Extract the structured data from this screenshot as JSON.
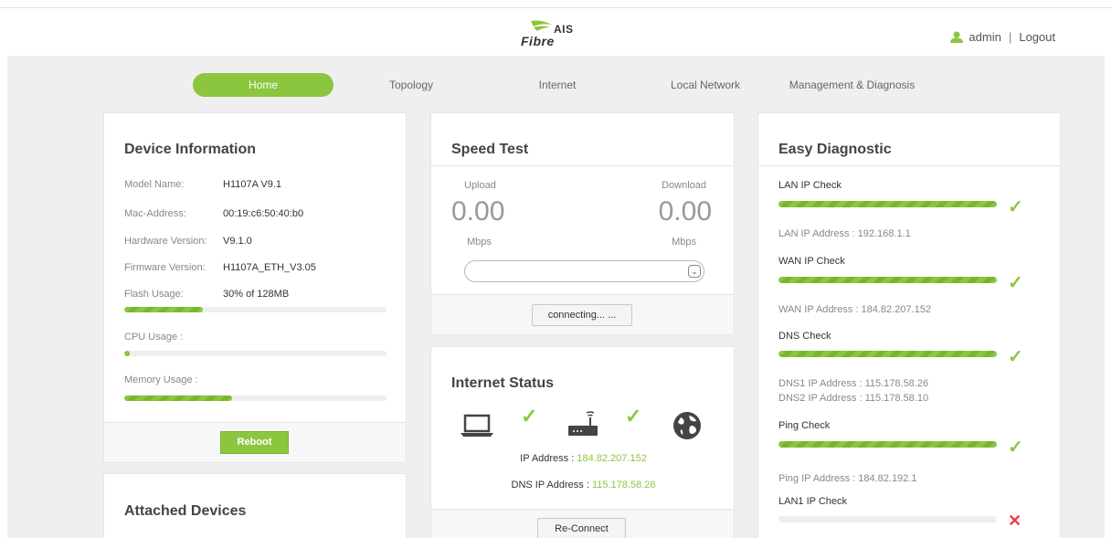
{
  "header": {
    "logo_top": "AIS",
    "logo_bottom": "Fibre",
    "user": "admin",
    "separator": "|",
    "logout": "Logout"
  },
  "nav": {
    "home": "Home",
    "topology": "Topology",
    "internet": "Internet",
    "local_network": "Local Network",
    "management": "Management & Diagnosis"
  },
  "device_info": {
    "title": "Device Information",
    "rows": [
      {
        "label": "Model Name:",
        "value": "H1107A V9.1"
      },
      {
        "label": "Mac-Address:",
        "value": "00:19:c6:50:40:b0"
      },
      {
        "label": "Hardware Version:",
        "value": "V9.1.0"
      },
      {
        "label": "Firmware Version:",
        "value": "H1107A_ETH_V3.05"
      },
      {
        "label": "Flash Usage:",
        "value": "30% of 128MB"
      }
    ],
    "flash_usage_fraction": 0.3,
    "cpu_label": "CPU Usage :",
    "cpu_usage_fraction": 0.02,
    "memory_label": "Memory Usage :",
    "memory_usage_fraction": 0.41,
    "reboot": "Reboot"
  },
  "attached_devices": {
    "title": "Attached Devices"
  },
  "speed_test": {
    "title": "Speed Test",
    "upload_label": "Upload",
    "download_label": "Download",
    "upload_value": "0.00",
    "download_value": "0.00",
    "upload_unit": "Mbps",
    "download_unit": "Mbps",
    "select_value": "",
    "button": "connecting... ..."
  },
  "internet_status": {
    "title": "Internet Status",
    "ip_label": "IP Address : ",
    "ip_value": "184.82.207.152",
    "dns_label": "DNS IP Address : ",
    "dns_value": "115.178.58.26",
    "reconnect": "Re-Connect"
  },
  "easy_diagnostic": {
    "title": "Easy Diagnostic",
    "lan_check": "LAN IP Check",
    "lan_info": "LAN IP Address : 192.168.1.1",
    "wan_check": "WAN IP Check",
    "wan_info": "WAN IP Address : 184.82.207.152",
    "dns_check": "DNS Check",
    "dns1_info": "DNS1 IP Address : 115.178.58.26",
    "dns2_info": "DNS2 IP Address : 115.178.58.10",
    "ping_check": "Ping Check",
    "ping_info": "Ping IP Address : 184.82.192.1",
    "lan1_check": "LAN1 IP Check",
    "check_mark": "✓",
    "fail_mark": "✕"
  },
  "colors": {
    "accent": "#8cc63f",
    "error": "#ee3a43"
  }
}
